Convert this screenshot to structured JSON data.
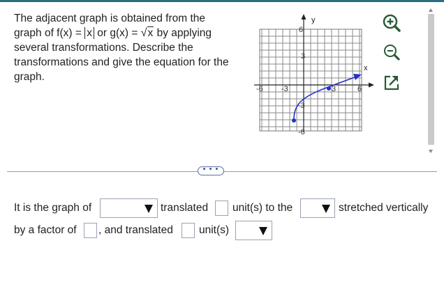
{
  "question": {
    "line1": "The adjacent graph is obtained from the",
    "line2_prefix": "graph of  f(x) = ",
    "line2_abs": "x",
    "line2_mid": " or g(x) = ",
    "line2_sqrt_symbol": "√",
    "line2_sqrt_arg": "x",
    "line2_suffix": " by applying",
    "line3": "several transformations. Describe the",
    "line4": "transformations and give the equation for the",
    "line5": "graph."
  },
  "graph": {
    "x_axis_label": "x",
    "y_axis_label": "y",
    "x_ticks": [
      "-6",
      "-3",
      "3",
      "6"
    ],
    "y_ticks": [
      "6",
      "3",
      "-3",
      "-6"
    ],
    "curve_color": "#2431c9",
    "grid_color": "#8a8a8a"
  },
  "tools": {
    "zoom_in_icon": "zoom-in-icon",
    "zoom_out_icon": "zoom-out-icon",
    "popout_icon": "external-link-icon",
    "accent": "#2a5a38"
  },
  "more_button_label": "• • •",
  "answer": {
    "line1_prefix": "It is the graph of",
    "translated_label": "translated",
    "units_to_the": "unit(s) to the",
    "stretched": "stretched vertically",
    "by_a_factor": "by a factor of",
    "and_translated": ", and translated",
    "units": "unit(s)"
  }
}
